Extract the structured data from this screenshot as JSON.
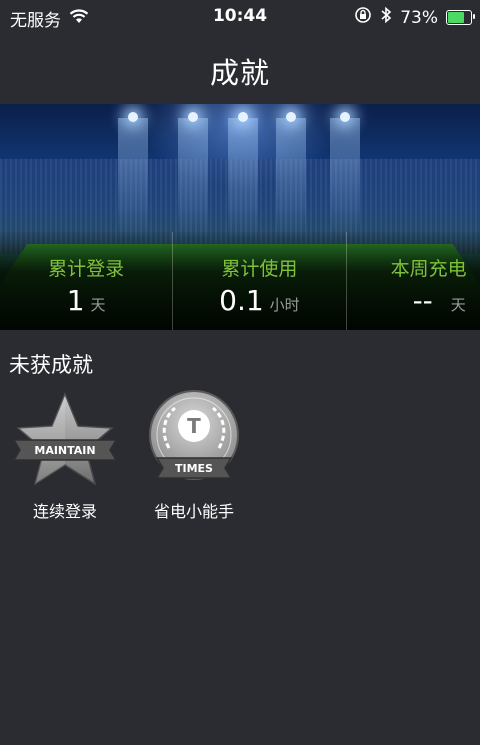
{
  "status_bar": {
    "carrier": "无服务",
    "time": "10:44",
    "battery_percent": "73%",
    "battery_level": 0.73,
    "icons": [
      "wifi-icon",
      "orientation-lock-icon",
      "bluetooth-icon",
      "battery-icon"
    ],
    "battery_color": "#4cd964"
  },
  "nav": {
    "title": "成就"
  },
  "stats": [
    {
      "label": "累计登录",
      "value": "1",
      "unit": "天"
    },
    {
      "label": "累计使用",
      "value": "0.1",
      "unit": "小时"
    },
    {
      "label": "本周充电",
      "value": "--",
      "unit": "天"
    }
  ],
  "accent_color": "#7fc13a",
  "section": {
    "title": "未获成就"
  },
  "achievements": [
    {
      "label": "连续登录",
      "badge_text": "MAINTAIN",
      "icon": "star-badge-icon"
    },
    {
      "label": "省电小能手",
      "badge_text": "TIMES",
      "badge_letter": "T",
      "icon": "laurel-medal-icon"
    }
  ]
}
